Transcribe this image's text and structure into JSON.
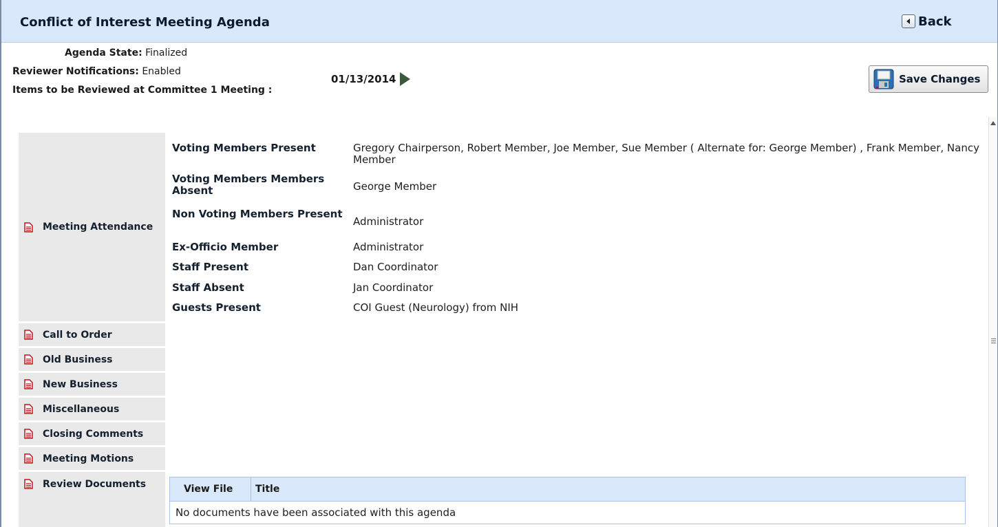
{
  "header": {
    "title": "Conflict of Interest Meeting Agenda",
    "back_label": "Back"
  },
  "info": {
    "agenda_state_label": "Agenda State:",
    "agenda_state_value": "Finalized",
    "reviewer_notifications_label": "Reviewer Notifications:",
    "reviewer_notifications_value": "Enabled",
    "items_label": "Items to be Reviewed at Committee 1 Meeting :"
  },
  "meeting_date": "01/13/2014",
  "save_label": "Save Changes",
  "sidebar": {
    "items": [
      {
        "label": "Meeting Attendance"
      },
      {
        "label": "Call to Order"
      },
      {
        "label": "Old Business"
      },
      {
        "label": "New Business"
      },
      {
        "label": "Miscellaneous"
      },
      {
        "label": "Closing Comments"
      },
      {
        "label": "Meeting Motions"
      },
      {
        "label": "Review Documents"
      }
    ]
  },
  "attendance": [
    {
      "label": "Voting Members Present",
      "value": "Gregory Chairperson, Robert Member, Joe Member, Sue Member ( Alternate for: George Member) , Frank Member, Nancy Member"
    },
    {
      "label": "Voting Members Members Absent",
      "value": "George Member"
    },
    {
      "label": "Non Voting Members Present",
      "value": "Administrator"
    },
    {
      "label": "Ex-Officio Member",
      "value": "Administrator"
    },
    {
      "label": "Staff Present",
      "value": "Dan Coordinator"
    },
    {
      "label": "Staff Absent",
      "value": "Jan Coordinator"
    },
    {
      "label": "Guests Present",
      "value": "COI Guest (Neurology) from NIH"
    }
  ],
  "documents": {
    "columns": [
      "View File",
      "Title"
    ],
    "empty_message": "No documents have been associated with this agenda"
  },
  "colors": {
    "header_bg": "#d9e8fb",
    "sidebar_bg": "#e9e9e9",
    "doc_icon": "#c0161b",
    "date_arrow": "#3b5a3b"
  },
  "icons": {
    "back": "back-arrow-icon",
    "save": "floppy-disk-icon",
    "sidebar": "document-icon",
    "date_next": "next-arrow-icon"
  }
}
